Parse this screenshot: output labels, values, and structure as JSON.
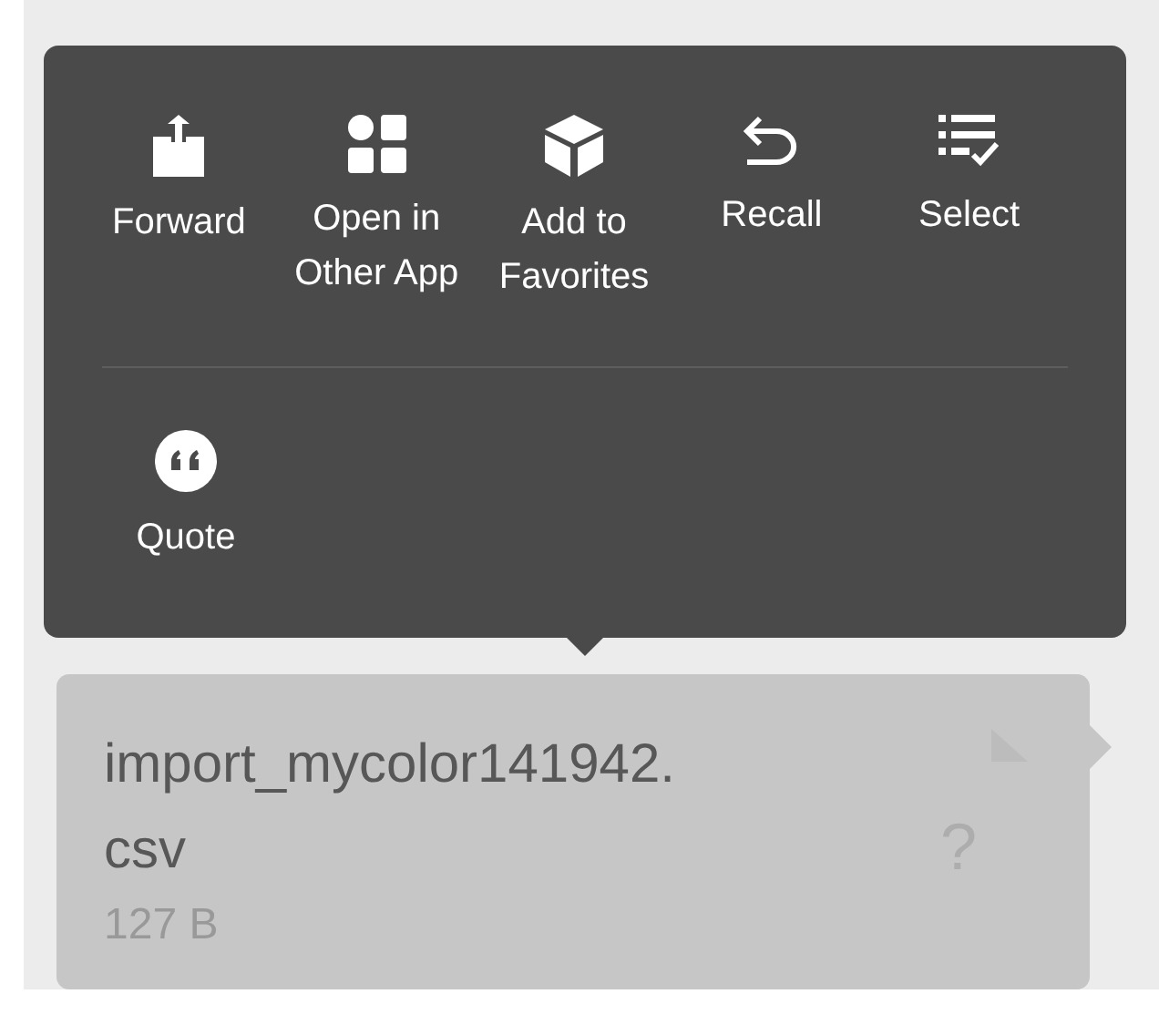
{
  "menu": {
    "rows": [
      [
        {
          "kind": "forward",
          "label": "Forward"
        },
        {
          "kind": "open",
          "label": "Open in\nOther App"
        },
        {
          "kind": "favorite",
          "label": "Add to\nFavorites"
        },
        {
          "kind": "recall",
          "label": "Recall"
        },
        {
          "kind": "select",
          "label": "Select"
        }
      ],
      [
        {
          "kind": "quote",
          "label": "Quote"
        }
      ]
    ]
  },
  "file_message": {
    "name_lines": [
      "import_mycolor141942.",
      "csv"
    ],
    "size": "127 B",
    "status": "?"
  }
}
